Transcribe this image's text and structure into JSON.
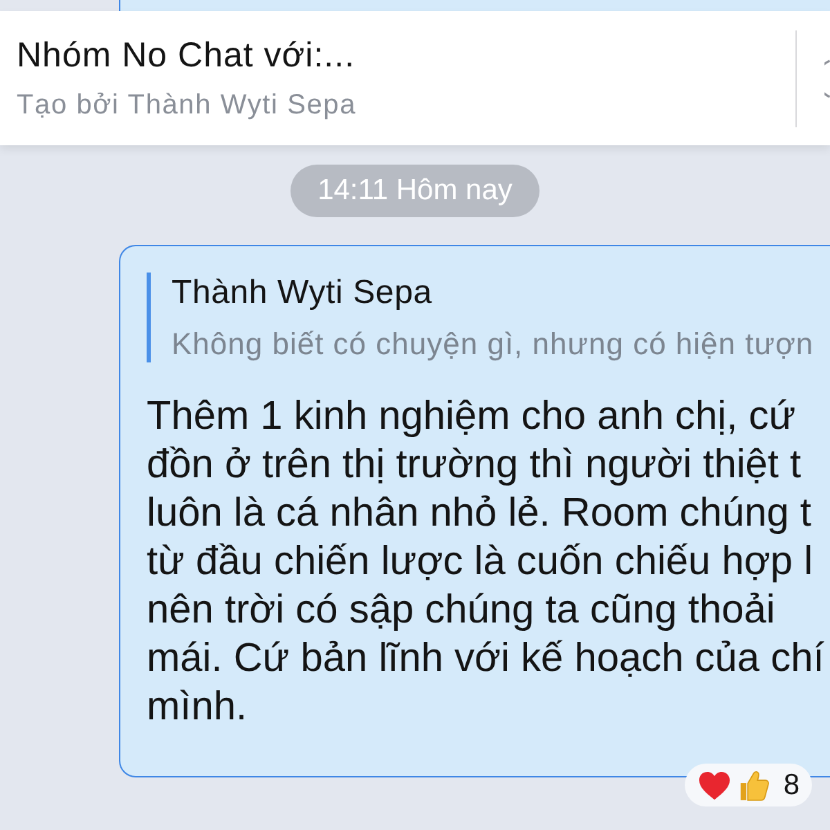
{
  "header": {
    "title": "Nhóm No Chat với:...",
    "subtitle": "Tạo bởi Thành Wyti Sepa"
  },
  "date_divider": "14:11 Hôm nay",
  "messages": [
    {
      "reply_to": {
        "sender": "Thành Wyti Sepa",
        "text": "Không biết có chuyện gì, nhưng có hiện tượn"
      },
      "lines": [
        "Thêm 1 kinh nghiệm cho anh chị, cứ",
        "đồn ở trên thị trường thì người thiệt t",
        "luôn là cá nhân nhỏ lẻ. Room chúng t",
        "từ đầu chiến lược là cuốn chiếu hợp l",
        "nên trời có sập chúng ta cũng thoải",
        "mái. Cứ bản lĩnh với kế hoạch của chí",
        "mình."
      ],
      "reactions": [
        {
          "kind": "heart"
        },
        {
          "kind": "thumbs_up"
        }
      ],
      "reaction_count": "8"
    }
  ]
}
